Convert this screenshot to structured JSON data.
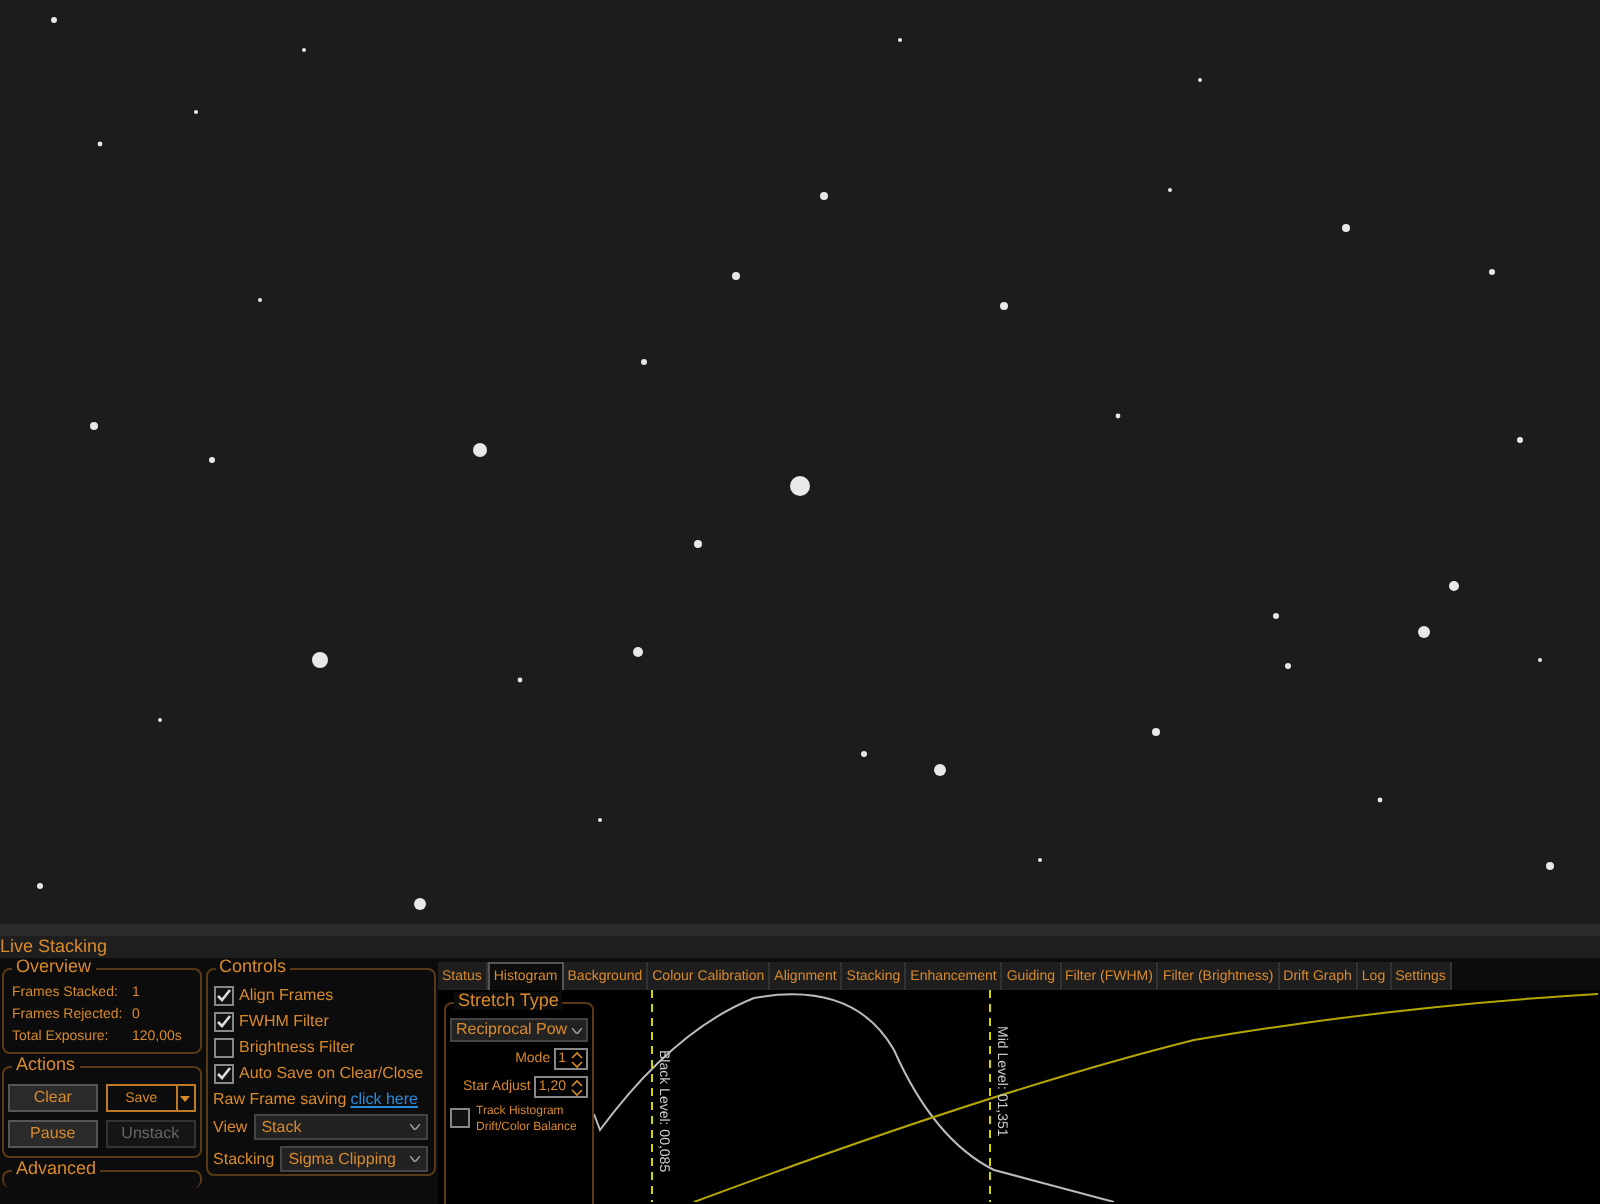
{
  "panel_title": "Live Stacking",
  "overview": {
    "title": "Overview",
    "rows": [
      {
        "label": "Frames Stacked:",
        "value": "1"
      },
      {
        "label": "Frames Rejected:",
        "value": "0"
      },
      {
        "label": "Total Exposure:",
        "value": "120,00s"
      }
    ]
  },
  "actions": {
    "title": "Actions",
    "buttons": [
      {
        "label": "Clear",
        "disabled": false,
        "kind": "plain"
      },
      {
        "label": "Save",
        "disabled": false,
        "kind": "split"
      },
      {
        "label": "Pause",
        "disabled": false,
        "kind": "plain"
      },
      {
        "label": "Unstack",
        "disabled": true,
        "kind": "plain"
      }
    ]
  },
  "advanced": {
    "title": "Advanced"
  },
  "controls": {
    "title": "Controls",
    "checkboxes": [
      {
        "label": "Align Frames",
        "checked": true
      },
      {
        "label": "FWHM Filter",
        "checked": true
      },
      {
        "label": "Brightness Filter",
        "checked": false
      },
      {
        "label": "Auto Save on Clear/Close",
        "checked": true
      }
    ],
    "raw_frame": {
      "label": "Raw Frame saving",
      "link": "click here"
    },
    "selects": [
      {
        "label": "View",
        "value": "Stack"
      },
      {
        "label": "Stacking",
        "value": "Sigma Clipping"
      }
    ]
  },
  "tabs": [
    {
      "label": "Status",
      "selected": false
    },
    {
      "label": "Histogram",
      "selected": true
    },
    {
      "label": "Background",
      "selected": false
    },
    {
      "label": "Colour Calibration",
      "selected": false
    },
    {
      "label": "Alignment",
      "selected": false
    },
    {
      "label": "Stacking",
      "selected": false
    },
    {
      "label": "Enhancement",
      "selected": false
    },
    {
      "label": "Guiding",
      "selected": false
    },
    {
      "label": "Filter (FWHM)",
      "selected": false
    },
    {
      "label": "Filter (Brightness)",
      "selected": false
    },
    {
      "label": "Drift Graph",
      "selected": false
    },
    {
      "label": "Log",
      "selected": false
    },
    {
      "label": "Settings",
      "selected": false
    }
  ],
  "stretch": {
    "title": "Stretch Type",
    "type": "Reciprocal Pow",
    "mode_label": "Mode",
    "mode": "1",
    "star_label": "Star Adjust",
    "star": "1,20",
    "track": {
      "label": "Track Histogram Drift/Color Balance",
      "checked": false
    }
  },
  "histogram": {
    "black_level": "Black Level: 00,085",
    "mid_level": "Mid Level: 01,351"
  }
}
